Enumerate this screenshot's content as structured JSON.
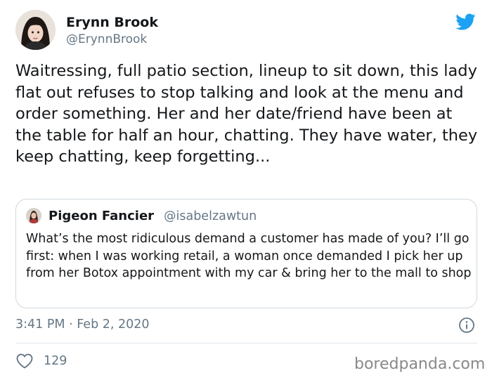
{
  "author": {
    "display_name": "Erynn Brook",
    "handle": "@ErynnBrook",
    "avatar_icon": "user-avatar-portrait"
  },
  "brand": {
    "logo_icon": "twitter-bird-icon",
    "color": "#1DA1F2"
  },
  "tweet": {
    "text": "Waitressing, full patio section, lineup to sit down, this lady flat out refuses to stop talking and look at the menu and order something. Her and her date/friend have been at the table for half an hour, chatting. They have water, they keep chatting, keep forgetting..."
  },
  "quoted_tweet": {
    "display_name": "Pigeon Fancier",
    "handle": "@isabelzawtun",
    "avatar_icon": "user-avatar-small",
    "text": "What’s the most ridiculous demand a customer has made of you? I’ll go first: when I was working retail, a woman once demanded I pick her up from her Botox appointment with my car & bring her to the mall to shop"
  },
  "meta": {
    "timestamp": "3:41 PM · Feb 2, 2020",
    "info_icon": "info-circle-icon"
  },
  "actions": {
    "like_icon": "heart-outline-icon",
    "like_count": "129"
  },
  "watermark": {
    "text": "boredpanda.com"
  },
  "colors": {
    "text_primary": "#14171A",
    "text_secondary": "#657786",
    "border": "#CFD9DE"
  }
}
